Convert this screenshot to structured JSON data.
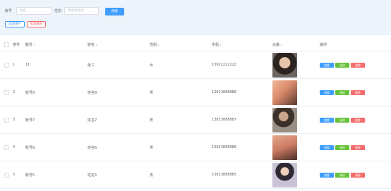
{
  "filters": {
    "account_label": "账号",
    "name_placeholder": "姓名",
    "gender_label": "性别",
    "gender_placeholder": "请选择性别",
    "search_label": "搜索",
    "add_label": "添加用户",
    "batch_delete_label": "批量删除"
  },
  "table": {
    "columns": [
      "序号",
      "账号",
      "姓名",
      "性别",
      "手机",
      "头像",
      "操作"
    ],
    "action_labels": {
      "view": "查看",
      "edit": "修改",
      "delete": "删除"
    },
    "rows": [
      {
        "index": "1",
        "account": "11",
        "name": "张三",
        "gender": "女",
        "phone": "13922222222"
      },
      {
        "index": "2",
        "account": "账号8",
        "name": "姓名8",
        "gender": "男",
        "phone": "13823888888"
      },
      {
        "index": "3",
        "account": "账号7",
        "name": "姓名7",
        "gender": "男",
        "phone": "13823888887"
      },
      {
        "index": "4",
        "account": "账号6",
        "name": "姓名6",
        "gender": "男",
        "phone": "13823888886"
      },
      {
        "index": "5",
        "account": "账号5",
        "name": "姓名5",
        "gender": "男",
        "phone": "13823888885"
      }
    ]
  },
  "colors": {
    "primary": "#409eff",
    "success": "#67c23a",
    "danger": "#f56c6c",
    "filter_bg": "#eef4fb"
  }
}
